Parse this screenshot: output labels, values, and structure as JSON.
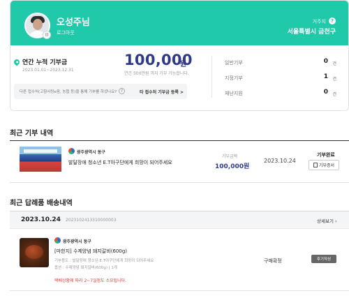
{
  "profile": {
    "user_name": "오성주님",
    "logout_label": "로그아웃",
    "region_label": "거주지",
    "region_help": "?",
    "region_value": "서울특별시 금천구",
    "avatar_badge": "⚙"
  },
  "summary": {
    "title": "연간 누적 기부금",
    "period": "2023.01.01~2023.12.31",
    "amount": "100,000",
    "amount_unit": "원",
    "amount_note": "연간 500만원 까지 기부 가능합니다.",
    "info_text": "다른 접수처(고향사랑e음, 농협 등)을 통해 기부를 하셨나요?",
    "info_help": "?",
    "info_link": "타 접수처 기부금 등록 >",
    "stats": [
      {
        "label": "일반기부",
        "value": "0",
        "unit": "건"
      },
      {
        "label": "지정기부",
        "value": "1",
        "unit": "건"
      },
      {
        "label": "재난지원",
        "value": "0",
        "unit": "건"
      }
    ]
  },
  "recent_donations": {
    "title": "최근 기부 내역",
    "items": [
      {
        "org_name": "광주광역시 동구",
        "title": "발달장애 청소년 E.T아구단에게 희망이 되어주세요",
        "amount_label": "기부금액",
        "amount": "100,000원",
        "date": "2023.10.24",
        "status": "기부완료",
        "receipt_label": "기부증서"
      }
    ]
  },
  "recent_gifts": {
    "title": "최근 답례품 배송내역",
    "order": {
      "date": "2023.10.24",
      "order_no": "2023102413310000003",
      "detail_label": "상세보기",
      "item": {
        "org_name": "광주광역시 동구",
        "name": "[마한지] 수제양념 돼지갈비(600g)",
        "usage_line": "기부용도 : 발달장애 청소년 E.T야구단에게 희망이 되어주세요",
        "option_line": "옵션 : 수제양념 돼지갈비(600g)  |  1개",
        "warning": "택배상황에 따라 2~7일정도 소요됩니다.",
        "status": "구매확정",
        "review_label": "후기작성"
      }
    }
  },
  "colors": {
    "accent": "#1fc9aa",
    "amount": "#2f3a86",
    "warning": "#e53935"
  }
}
